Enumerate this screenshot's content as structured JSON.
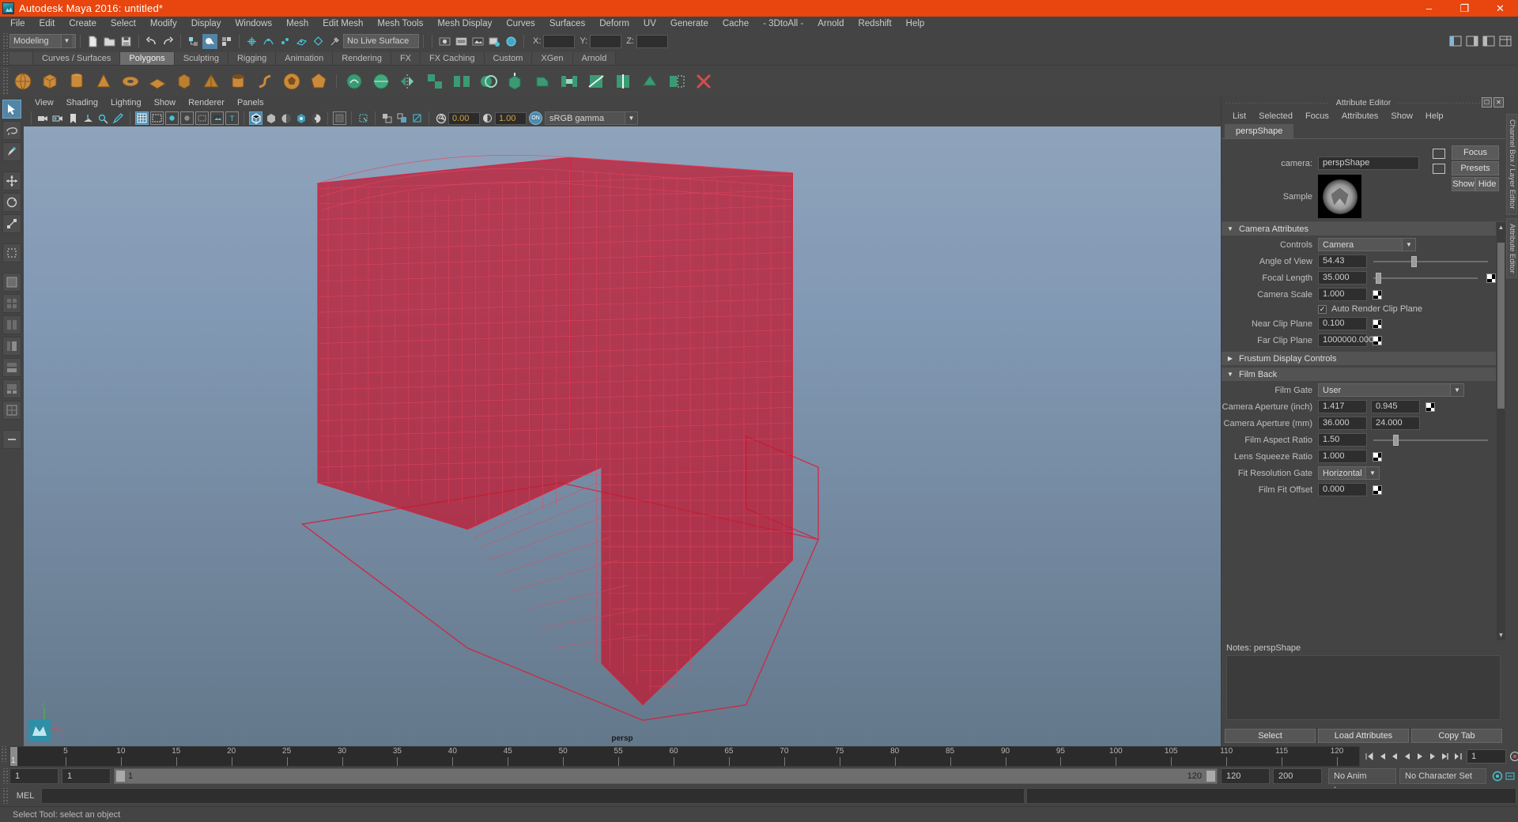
{
  "window": {
    "title": "Autodesk Maya 2016: untitled*",
    "accent": "#e8460e",
    "minimize": "–",
    "maximize": "❐",
    "close": "✕"
  },
  "menubar": {
    "items": [
      "File",
      "Edit",
      "Create",
      "Select",
      "Modify",
      "Display",
      "Windows",
      "Mesh",
      "Edit Mesh",
      "Mesh Tools",
      "Mesh Display",
      "Curves",
      "Surfaces",
      "Deform",
      "UV",
      "Generate",
      "Cache",
      "- 3DtoAll -",
      "Arnold",
      "Redshift",
      "Help"
    ]
  },
  "statusbar": {
    "menuset": "Modeling",
    "live_surface": "No Live Surface",
    "axis_x": "X:",
    "axis_y": "Y:",
    "axis_z": "Z:",
    "x_value": "",
    "y_value": "",
    "z_value": ""
  },
  "shelf": {
    "tabs": [
      "Curves / Surfaces",
      "Polygons",
      "Sculpting",
      "Rigging",
      "Animation",
      "Rendering",
      "FX",
      "FX Caching",
      "Custom",
      "XGen",
      "Arnold"
    ],
    "active_tab": "Polygons"
  },
  "viewport_panel": {
    "menus": [
      "View",
      "Shading",
      "Lighting",
      "Show",
      "Renderer",
      "Panels"
    ],
    "exposure_value": "0.00",
    "gamma_value": "1.00",
    "color_mode": "sRGB gamma",
    "toggle_state": "ON",
    "camera_label": "persp",
    "axis_x": "x",
    "axis_y": "y",
    "axis_z": "z",
    "background_top": "#8fa3bb",
    "background_bottom": "#64788c",
    "wireframe_color": "#d91f3c"
  },
  "attribute_editor": {
    "panel_title": "Attribute Editor",
    "menus": [
      "List",
      "Selected",
      "Focus",
      "Attributes",
      "Show",
      "Help"
    ],
    "node_tab": "perspShape",
    "camera_label": "camera:",
    "camera_value": "perspShape",
    "buttons": {
      "focus": "Focus",
      "presets": "Presets",
      "show": "Show",
      "hide": "Hide"
    },
    "sample_label": "Sample",
    "sections": [
      {
        "title": "Camera Attributes",
        "expanded": true,
        "fields": [
          {
            "label": "Controls",
            "type": "dropdown",
            "value": "Camera"
          },
          {
            "label": "Angle of View",
            "type": "slider",
            "value": "54.43",
            "slider_pct": 33
          },
          {
            "label": "Focal Length",
            "type": "slider",
            "value": "35.000",
            "slider_pct": 2,
            "checker": true
          },
          {
            "label": "Camera Scale",
            "type": "num",
            "value": "1.000",
            "checker": true
          },
          {
            "label": "",
            "type": "checkbox",
            "value": "Auto Render Clip Plane",
            "checked": true
          },
          {
            "label": "Near Clip Plane",
            "type": "num",
            "value": "0.100",
            "checker": true
          },
          {
            "label": "Far Clip Plane",
            "type": "num",
            "value": "1000000.000",
            "checker": true
          }
        ]
      },
      {
        "title": "Frustum Display Controls",
        "expanded": false,
        "fields": []
      },
      {
        "title": "Film Back",
        "expanded": true,
        "fields": [
          {
            "label": "Film Gate",
            "type": "dropdown",
            "value": "User"
          },
          {
            "label": "Camera Aperture (inch)",
            "type": "num2",
            "value": "1.417",
            "value2": "0.945",
            "checker": true
          },
          {
            "label": "Camera Aperture (mm)",
            "type": "num2",
            "value": "36.000",
            "value2": "24.000"
          },
          {
            "label": "Film Aspect Ratio",
            "type": "slider",
            "value": "1.50",
            "slider_pct": 17
          },
          {
            "label": "Lens Squeeze Ratio",
            "type": "num",
            "value": "1.000",
            "checker": true
          },
          {
            "label": "Fit Resolution Gate",
            "type": "dropdown_small",
            "value": "Horizontal"
          },
          {
            "label": "Film Fit Offset",
            "type": "num",
            "value": "0.000",
            "checker": true
          }
        ]
      }
    ],
    "notes_label": "Notes: perspShape",
    "footer": [
      "Select",
      "Load Attributes",
      "Copy Tab"
    ]
  },
  "side_tabs": [
    "Channel Box / Layer Editor",
    "Attribute Editor"
  ],
  "timeline": {
    "ticks": [
      5,
      10,
      15,
      20,
      25,
      30,
      35,
      40,
      45,
      50,
      55,
      60,
      65,
      70,
      75,
      80,
      85,
      90,
      95,
      100,
      105,
      110,
      115,
      120
    ],
    "current_frame": "1",
    "frame_field": "1",
    "range_start": "1",
    "range_start2": "1",
    "slider_min": "1",
    "slider_max": "120",
    "end_field": "120",
    "playback_end": "200",
    "anim_layer": "No Anim Layer",
    "character_set": "No Character Set"
  },
  "command_line": {
    "label": "MEL",
    "input_value": "",
    "output_value": ""
  },
  "status_message": "Select Tool: select an object"
}
